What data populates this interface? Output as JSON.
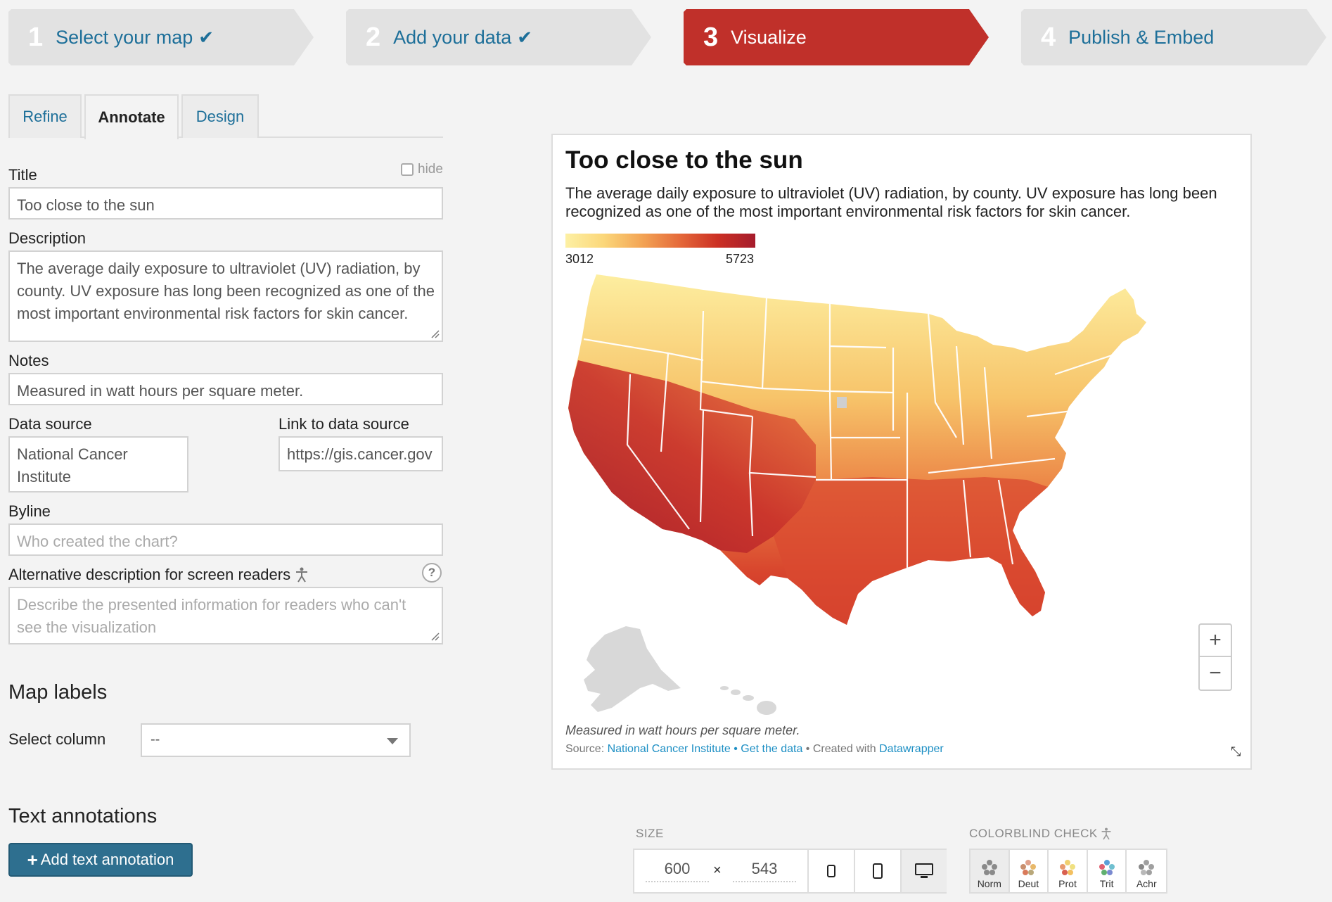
{
  "steps": [
    {
      "num": "1",
      "label": "Select your map",
      "done": true
    },
    {
      "num": "2",
      "label": "Add your data",
      "done": true
    },
    {
      "num": "3",
      "label": "Visualize",
      "active": true
    },
    {
      "num": "4",
      "label": "Publish & Embed"
    }
  ],
  "tabs": [
    "Refine",
    "Annotate",
    "Design"
  ],
  "form": {
    "title_label": "Title",
    "hide_label": "hide",
    "title_value": "Too close to the sun",
    "description_label": "Description",
    "description_value": "The average daily exposure to ultraviolet (UV) radiation, by county. UV exposure has long been recognized as one of the most important environmental risk factors for skin cancer.",
    "notes_label": "Notes",
    "notes_value": "Measured in watt hours per square meter.",
    "source_label": "Data source",
    "source_value": "National Cancer Institute",
    "link_label": "Link to data source",
    "link_value": "https://gis.cancer.gov",
    "byline_label": "Byline",
    "byline_placeholder": "Who created the chart?",
    "alt_label": "Alternative description for screen readers",
    "alt_placeholder": "Describe the presented information for readers who can't see the visualization",
    "help": "?"
  },
  "map_labels": {
    "heading": "Map labels",
    "select_label": "Select column",
    "select_value": "--"
  },
  "text_annotations": {
    "heading": "Text annotations",
    "add_button": "Add text annotation"
  },
  "preview": {
    "title": "Too close to the sun",
    "description": "The average daily exposure to ultraviolet (UV) radiation, by county. UV exposure has long been recognized as one of the most important environmental risk factors for skin cancer.",
    "legend_min": "3012",
    "legend_max": "5723",
    "notes": "Measured in watt hours per square meter.",
    "source_prefix": "Source: ",
    "source_name": "National Cancer Institute",
    "sep1": " • ",
    "get_data": "Get the data",
    "sep2": " • Created with ",
    "created_with": "Datawrapper",
    "zoom_in": "+",
    "zoom_out": "−",
    "colors": {
      "low": "#fdf0a4",
      "high": "#a51c2c"
    }
  },
  "size": {
    "label": "SIZE",
    "width": "600",
    "height": "543",
    "x": "×"
  },
  "colorblind": {
    "label": "COLORBLIND CHECK",
    "modes": [
      "Norm",
      "Deut",
      "Prot",
      "Trit",
      "Achr"
    ]
  },
  "accent_color": "#c0302a",
  "link_color": "#1d6f99"
}
